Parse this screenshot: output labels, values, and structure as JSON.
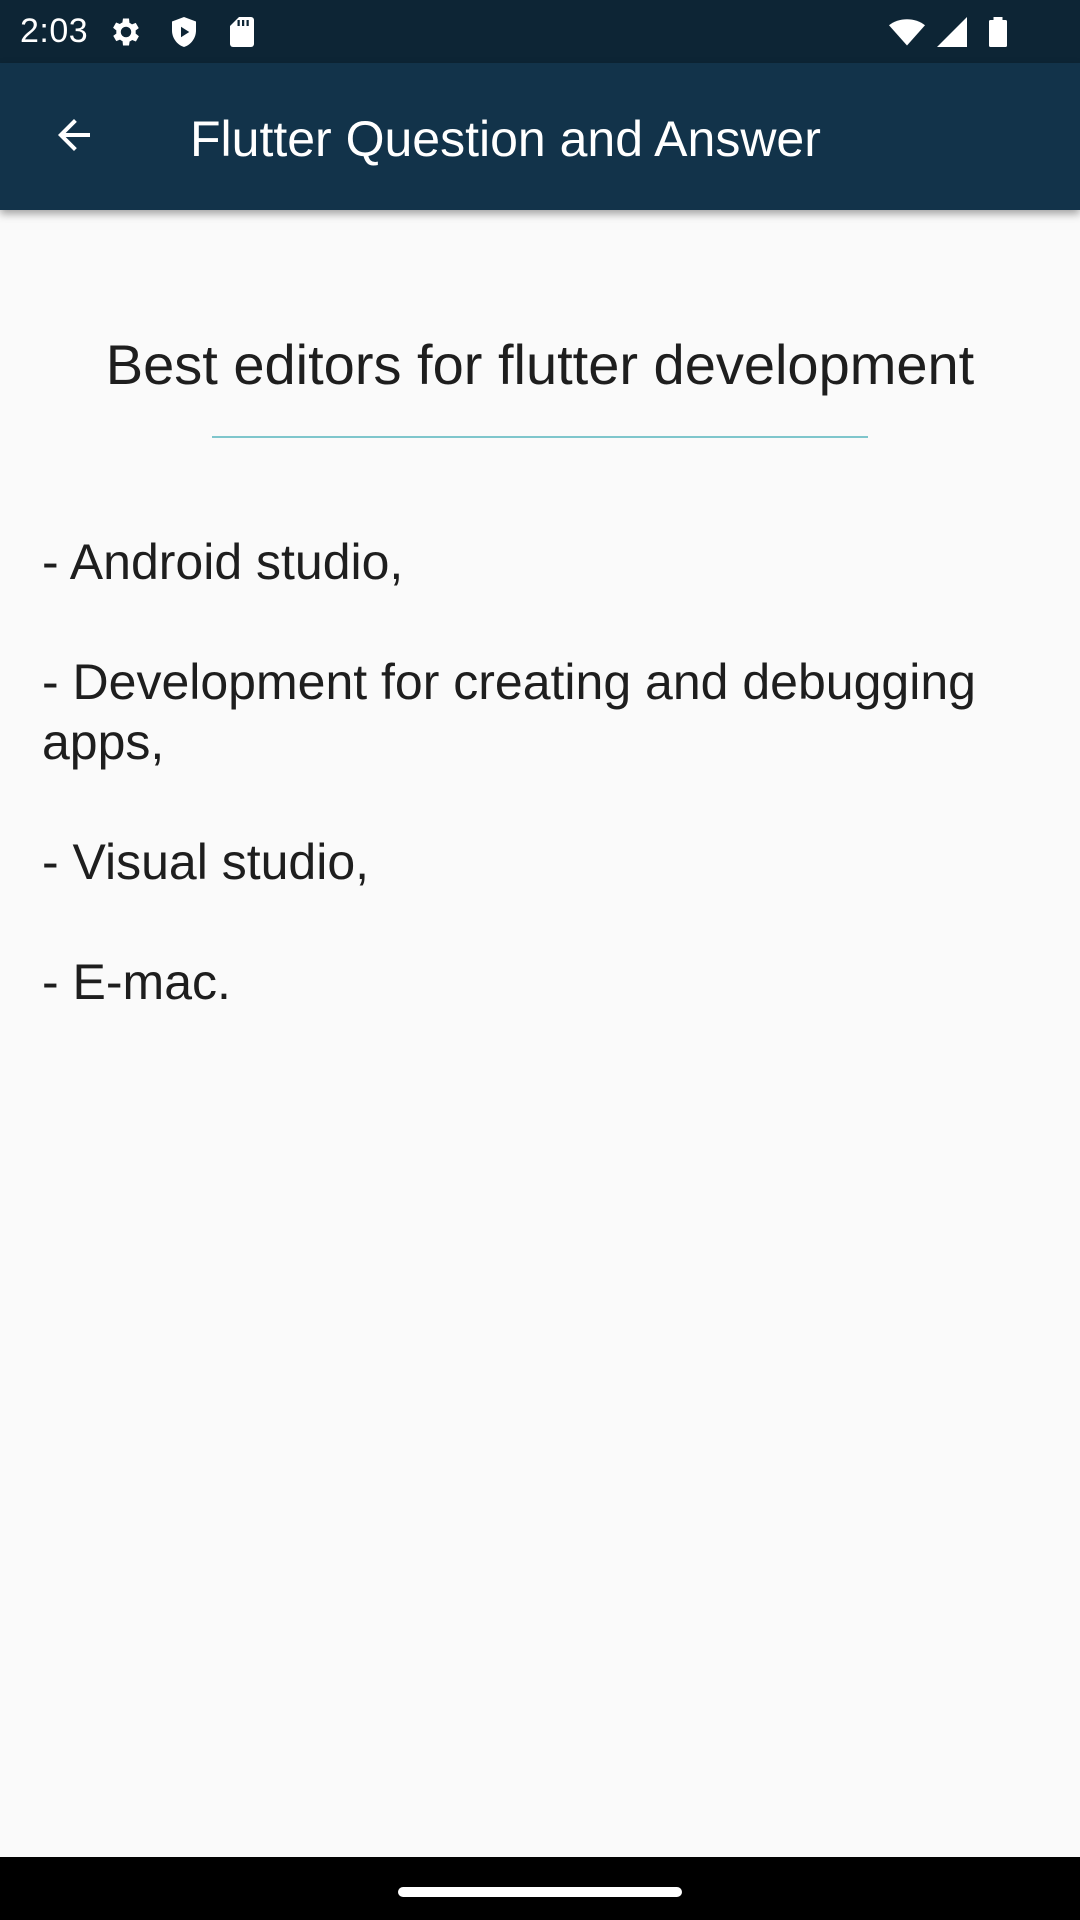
{
  "status_bar": {
    "time": "2:03",
    "left_icons": [
      "gear-icon",
      "shield-icon",
      "sd-card-icon"
    ],
    "right_icons": [
      "wifi-icon",
      "cellular-signal-icon",
      "battery-icon"
    ],
    "background_color": "#0d2535"
  },
  "app_bar": {
    "title": "Flutter Question and Answer",
    "back_icon": "arrow-back-icon",
    "background_color": "#12334a"
  },
  "question": {
    "title": "Best editors for flutter development",
    "divider_color": "#7fc6cc"
  },
  "answer": {
    "items": [
      "- Android studio,",
      "- Development for creating and debugging apps,",
      "- Visual studio,",
      "- E-mac."
    ]
  },
  "nav_bar": {
    "home_indicator": "home-indicator"
  }
}
